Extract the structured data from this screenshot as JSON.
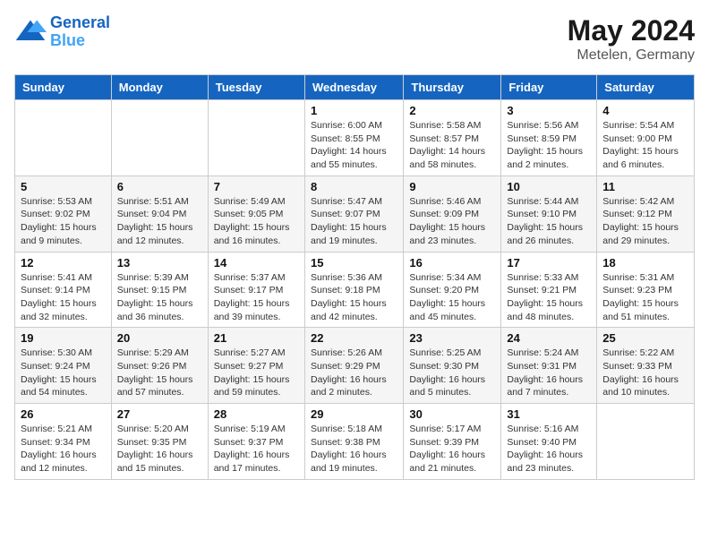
{
  "logo": {
    "line1": "General",
    "line2": "Blue"
  },
  "title": {
    "month_year": "May 2024",
    "location": "Metelen, Germany"
  },
  "header": {
    "days": [
      "Sunday",
      "Monday",
      "Tuesday",
      "Wednesday",
      "Thursday",
      "Friday",
      "Saturday"
    ]
  },
  "weeks": [
    {
      "cells": [
        {
          "empty": true
        },
        {
          "empty": true
        },
        {
          "empty": true
        },
        {
          "day": "1",
          "sunrise": "6:00 AM",
          "sunset": "8:55 PM",
          "daylight": "14 hours and 55 minutes."
        },
        {
          "day": "2",
          "sunrise": "5:58 AM",
          "sunset": "8:57 PM",
          "daylight": "14 hours and 58 minutes."
        },
        {
          "day": "3",
          "sunrise": "5:56 AM",
          "sunset": "8:59 PM",
          "daylight": "15 hours and 2 minutes."
        },
        {
          "day": "4",
          "sunrise": "5:54 AM",
          "sunset": "9:00 PM",
          "daylight": "15 hours and 6 minutes."
        }
      ]
    },
    {
      "cells": [
        {
          "day": "5",
          "sunrise": "5:53 AM",
          "sunset": "9:02 PM",
          "daylight": "15 hours and 9 minutes."
        },
        {
          "day": "6",
          "sunrise": "5:51 AM",
          "sunset": "9:04 PM",
          "daylight": "15 hours and 12 minutes."
        },
        {
          "day": "7",
          "sunrise": "5:49 AM",
          "sunset": "9:05 PM",
          "daylight": "15 hours and 16 minutes."
        },
        {
          "day": "8",
          "sunrise": "5:47 AM",
          "sunset": "9:07 PM",
          "daylight": "15 hours and 19 minutes."
        },
        {
          "day": "9",
          "sunrise": "5:46 AM",
          "sunset": "9:09 PM",
          "daylight": "15 hours and 23 minutes."
        },
        {
          "day": "10",
          "sunrise": "5:44 AM",
          "sunset": "9:10 PM",
          "daylight": "15 hours and 26 minutes."
        },
        {
          "day": "11",
          "sunrise": "5:42 AM",
          "sunset": "9:12 PM",
          "daylight": "15 hours and 29 minutes."
        }
      ]
    },
    {
      "cells": [
        {
          "day": "12",
          "sunrise": "5:41 AM",
          "sunset": "9:14 PM",
          "daylight": "15 hours and 32 minutes."
        },
        {
          "day": "13",
          "sunrise": "5:39 AM",
          "sunset": "9:15 PM",
          "daylight": "15 hours and 36 minutes."
        },
        {
          "day": "14",
          "sunrise": "5:37 AM",
          "sunset": "9:17 PM",
          "daylight": "15 hours and 39 minutes."
        },
        {
          "day": "15",
          "sunrise": "5:36 AM",
          "sunset": "9:18 PM",
          "daylight": "15 hours and 42 minutes."
        },
        {
          "day": "16",
          "sunrise": "5:34 AM",
          "sunset": "9:20 PM",
          "daylight": "15 hours and 45 minutes."
        },
        {
          "day": "17",
          "sunrise": "5:33 AM",
          "sunset": "9:21 PM",
          "daylight": "15 hours and 48 minutes."
        },
        {
          "day": "18",
          "sunrise": "5:31 AM",
          "sunset": "9:23 PM",
          "daylight": "15 hours and 51 minutes."
        }
      ]
    },
    {
      "cells": [
        {
          "day": "19",
          "sunrise": "5:30 AM",
          "sunset": "9:24 PM",
          "daylight": "15 hours and 54 minutes."
        },
        {
          "day": "20",
          "sunrise": "5:29 AM",
          "sunset": "9:26 PM",
          "daylight": "15 hours and 57 minutes."
        },
        {
          "day": "21",
          "sunrise": "5:27 AM",
          "sunset": "9:27 PM",
          "daylight": "15 hours and 59 minutes."
        },
        {
          "day": "22",
          "sunrise": "5:26 AM",
          "sunset": "9:29 PM",
          "daylight": "16 hours and 2 minutes."
        },
        {
          "day": "23",
          "sunrise": "5:25 AM",
          "sunset": "9:30 PM",
          "daylight": "16 hours and 5 minutes."
        },
        {
          "day": "24",
          "sunrise": "5:24 AM",
          "sunset": "9:31 PM",
          "daylight": "16 hours and 7 minutes."
        },
        {
          "day": "25",
          "sunrise": "5:22 AM",
          "sunset": "9:33 PM",
          "daylight": "16 hours and 10 minutes."
        }
      ]
    },
    {
      "cells": [
        {
          "day": "26",
          "sunrise": "5:21 AM",
          "sunset": "9:34 PM",
          "daylight": "16 hours and 12 minutes."
        },
        {
          "day": "27",
          "sunrise": "5:20 AM",
          "sunset": "9:35 PM",
          "daylight": "16 hours and 15 minutes."
        },
        {
          "day": "28",
          "sunrise": "5:19 AM",
          "sunset": "9:37 PM",
          "daylight": "16 hours and 17 minutes."
        },
        {
          "day": "29",
          "sunrise": "5:18 AM",
          "sunset": "9:38 PM",
          "daylight": "16 hours and 19 minutes."
        },
        {
          "day": "30",
          "sunrise": "5:17 AM",
          "sunset": "9:39 PM",
          "daylight": "16 hours and 21 minutes."
        },
        {
          "day": "31",
          "sunrise": "5:16 AM",
          "sunset": "9:40 PM",
          "daylight": "16 hours and 23 minutes."
        },
        {
          "empty": true
        }
      ]
    }
  ],
  "labels": {
    "sunrise_prefix": "Sunrise: ",
    "sunset_prefix": "Sunset: ",
    "daylight_prefix": "Daylight: "
  }
}
